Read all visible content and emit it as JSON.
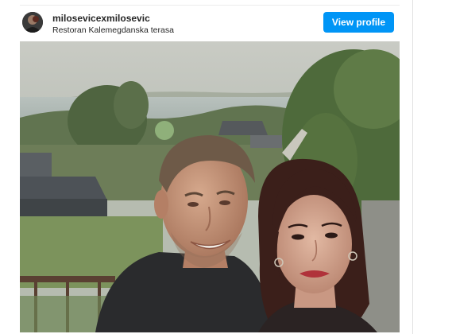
{
  "post": {
    "username": "milosevicexmilosevic",
    "location": "Restoran Kalemegdanska terasa",
    "view_profile_label": "View profile"
  },
  "colors": {
    "button_bg": "#0095f6",
    "button_text": "#ffffff",
    "text": "#262626"
  },
  "icons": {
    "avatar": "profile-avatar"
  }
}
